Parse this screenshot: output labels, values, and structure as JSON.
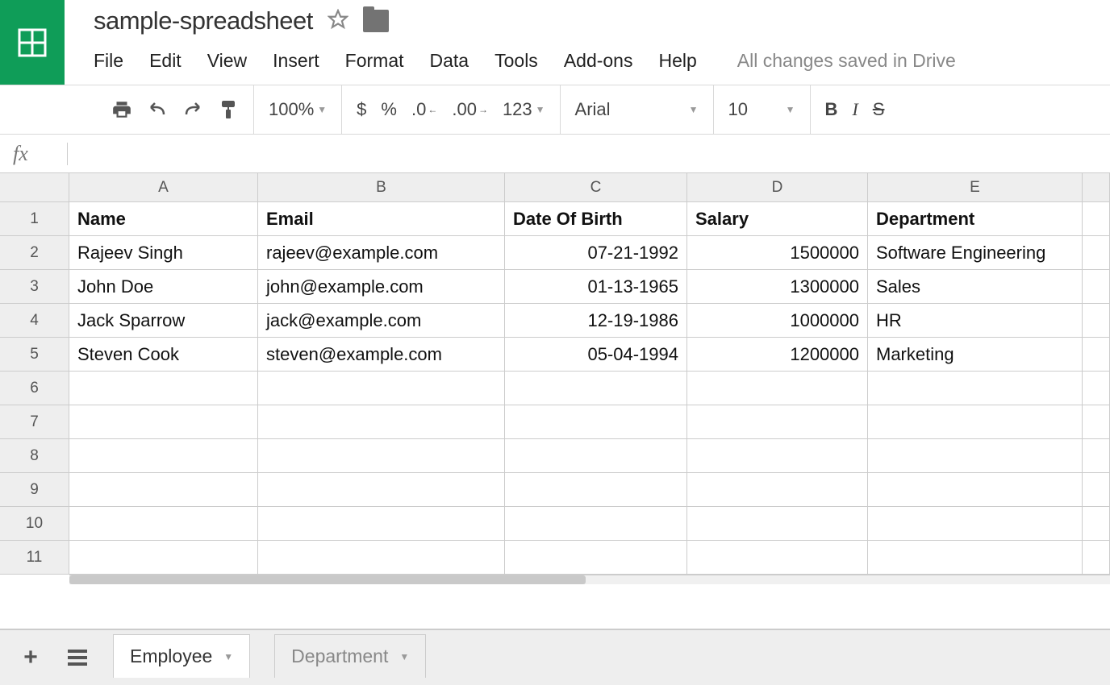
{
  "doc": {
    "title": "sample-spreadsheet",
    "save_status": "All changes saved in Drive"
  },
  "menus": {
    "file": "File",
    "edit": "Edit",
    "view": "View",
    "insert": "Insert",
    "format": "Format",
    "data": "Data",
    "tools": "Tools",
    "addons": "Add-ons",
    "help": "Help"
  },
  "toolbar": {
    "zoom": "100%",
    "currency": "$",
    "percent": "%",
    "dec_less": ".0",
    "dec_more": ".00",
    "num_format": "123",
    "font": "Arial",
    "font_size": "10",
    "bold": "B",
    "italic": "I",
    "strike": "S"
  },
  "formula_bar": {
    "fx_label": "fx"
  },
  "column_letters": [
    "A",
    "B",
    "C",
    "D",
    "E"
  ],
  "rows": [
    {
      "n": "1",
      "cells": [
        {
          "v": "Name",
          "h": true
        },
        {
          "v": "Email",
          "h": true
        },
        {
          "v": "Date Of Birth",
          "h": true
        },
        {
          "v": "Salary",
          "h": true
        },
        {
          "v": "Department",
          "h": true
        }
      ]
    },
    {
      "n": "2",
      "cells": [
        {
          "v": "Rajeev Singh"
        },
        {
          "v": "rajeev@example.com"
        },
        {
          "v": "07-21-1992",
          "r": true
        },
        {
          "v": "1500000",
          "r": true
        },
        {
          "v": "Software Engineering"
        }
      ]
    },
    {
      "n": "3",
      "cells": [
        {
          "v": "John Doe"
        },
        {
          "v": "john@example.com"
        },
        {
          "v": "01-13-1965",
          "r": true
        },
        {
          "v": "1300000",
          "r": true
        },
        {
          "v": "Sales"
        }
      ]
    },
    {
      "n": "4",
      "cells": [
        {
          "v": "Jack Sparrow"
        },
        {
          "v": "jack@example.com"
        },
        {
          "v": "12-19-1986",
          "r": true
        },
        {
          "v": "1000000",
          "r": true
        },
        {
          "v": "HR"
        }
      ]
    },
    {
      "n": "5",
      "cells": [
        {
          "v": "Steven Cook"
        },
        {
          "v": "steven@example.com"
        },
        {
          "v": "05-04-1994",
          "r": true
        },
        {
          "v": "1200000",
          "r": true
        },
        {
          "v": "Marketing"
        }
      ]
    },
    {
      "n": "6",
      "cells": [
        {
          "v": ""
        },
        {
          "v": ""
        },
        {
          "v": ""
        },
        {
          "v": ""
        },
        {
          "v": ""
        }
      ]
    },
    {
      "n": "7",
      "cells": [
        {
          "v": ""
        },
        {
          "v": ""
        },
        {
          "v": ""
        },
        {
          "v": ""
        },
        {
          "v": ""
        }
      ]
    },
    {
      "n": "8",
      "cells": [
        {
          "v": ""
        },
        {
          "v": ""
        },
        {
          "v": ""
        },
        {
          "v": ""
        },
        {
          "v": ""
        }
      ]
    },
    {
      "n": "9",
      "cells": [
        {
          "v": ""
        },
        {
          "v": ""
        },
        {
          "v": ""
        },
        {
          "v": ""
        },
        {
          "v": ""
        }
      ]
    },
    {
      "n": "10",
      "cells": [
        {
          "v": ""
        },
        {
          "v": ""
        },
        {
          "v": ""
        },
        {
          "v": ""
        },
        {
          "v": ""
        }
      ]
    },
    {
      "n": "11",
      "cells": [
        {
          "v": ""
        },
        {
          "v": ""
        },
        {
          "v": ""
        },
        {
          "v": ""
        },
        {
          "v": ""
        }
      ]
    }
  ],
  "tabs": {
    "active": "Employee",
    "inactive": "Department"
  }
}
